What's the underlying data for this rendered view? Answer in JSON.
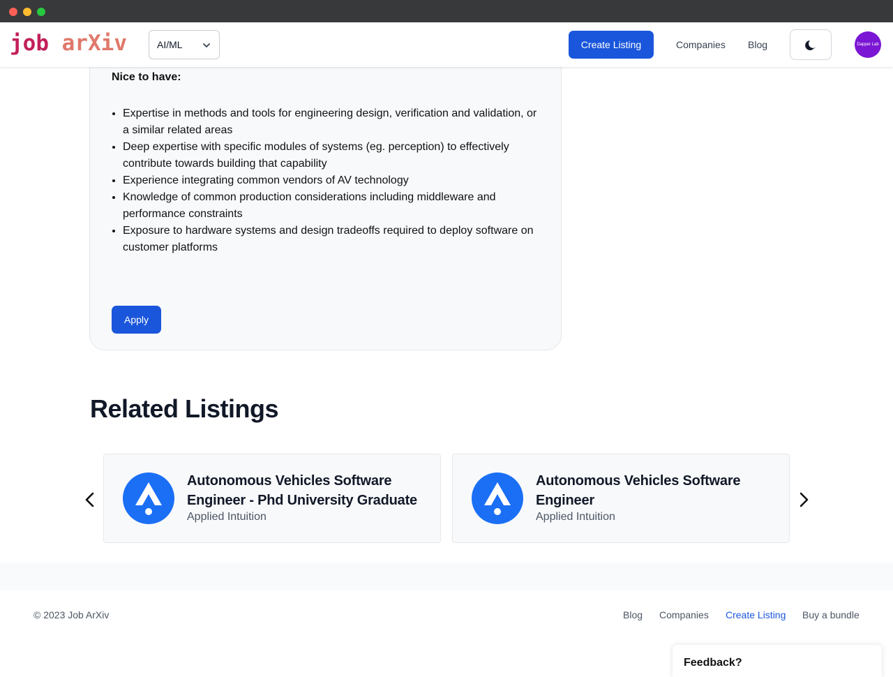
{
  "header": {
    "logo_part1": "job",
    "logo_part2": "arXiv",
    "category_select": "AI/ML",
    "create_listing": "Create Listing",
    "companies": "Companies",
    "blog": "Blog",
    "avatar_text": "Dapper Lab",
    "theme_icon": "moon-icon"
  },
  "job_card": {
    "section_heading": "Nice to have:",
    "bullets": [
      "Expertise in methods and tools for engineering design, verification and validation, or a similar related areas",
      "Deep expertise with specific modules of systems (eg. perception) to effectively contribute towards building that capability",
      "Experience integrating common vendors of AV technology",
      "Knowledge of common production considerations including middleware and performance constraints",
      "Exposure to hardware systems and design tradeoffs required to deploy software on customer platforms"
    ],
    "apply": "Apply"
  },
  "related": {
    "title": "Related Listings",
    "listings": [
      {
        "title": "Autonomous Vehicles Software Engineer - Phd University Graduate",
        "company": "Applied Intuition"
      },
      {
        "title": "Autonomous Vehicles Software Engineer",
        "company": "Applied Intuition"
      }
    ]
  },
  "footer": {
    "copyright": "© 2023 Job ArXiv",
    "links": [
      "Blog",
      "Companies",
      "Create Listing",
      "Buy a bundle"
    ]
  },
  "feedback": "Feedback?",
  "colors": {
    "primary": "#1a56db",
    "logo_red": "#c21f5a",
    "logo_salmon": "#e0786b",
    "avatar_purple": "#7b16d4",
    "company_logo_blue": "#1a6ff5"
  }
}
